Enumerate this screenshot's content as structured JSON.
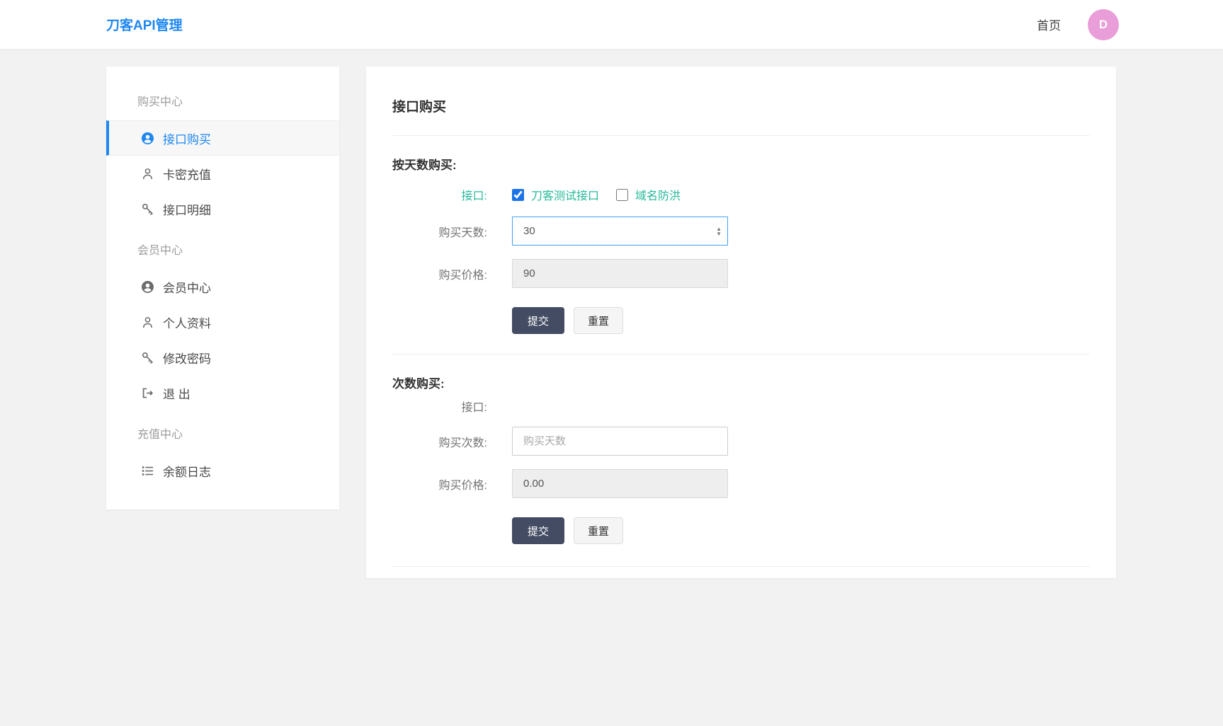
{
  "header": {
    "brand": "刀客API管理",
    "nav_home": "首页",
    "avatar_letter": "D"
  },
  "sidebar": {
    "sections": [
      {
        "title": "购买中心",
        "items": [
          {
            "label": "接口购买",
            "icon": "user-circle-icon",
            "active": true
          },
          {
            "label": "卡密充值",
            "icon": "user-outline-icon",
            "active": false
          },
          {
            "label": "接口明细",
            "icon": "key-icon",
            "active": false
          }
        ]
      },
      {
        "title": "会员中心",
        "items": [
          {
            "label": "会员中心",
            "icon": "user-circle-icon",
            "active": false
          },
          {
            "label": "个人资料",
            "icon": "user-outline-icon",
            "active": false
          },
          {
            "label": "修改密码",
            "icon": "key-icon",
            "active": false
          },
          {
            "label": "退 出",
            "icon": "sign-out-icon",
            "active": false
          }
        ]
      },
      {
        "title": "充值中心",
        "items": [
          {
            "label": "余额日志",
            "icon": "list-icon",
            "active": false
          }
        ]
      }
    ]
  },
  "main": {
    "title": "接口购买",
    "day_section": {
      "heading": "按天数购买:",
      "api_label": "接口:",
      "checkboxes": [
        {
          "label": "刀客测试接口",
          "checked": true
        },
        {
          "label": "域名防洪",
          "checked": false
        }
      ],
      "days_label": "购买天数:",
      "days_value": "30",
      "price_label": "购买价格:",
      "price_value": "90",
      "submit_label": "提交",
      "reset_label": "重置"
    },
    "count_section": {
      "heading": "次数购买:",
      "api_label": "接口:",
      "count_label": "购买次数:",
      "count_placeholder": "购买天数",
      "price_label": "购买价格:",
      "price_value": "0.00",
      "submit_label": "提交",
      "reset_label": "重置"
    }
  },
  "colors": {
    "brand_blue": "#1e87f0",
    "link_green": "#26b99a",
    "checkbox_blue": "#1a73e8",
    "focus_border": "#419ef9",
    "submit_navy": "#444c63",
    "avatar_pink": "#ea9ed9",
    "page_bg": "#f2f2f2"
  }
}
